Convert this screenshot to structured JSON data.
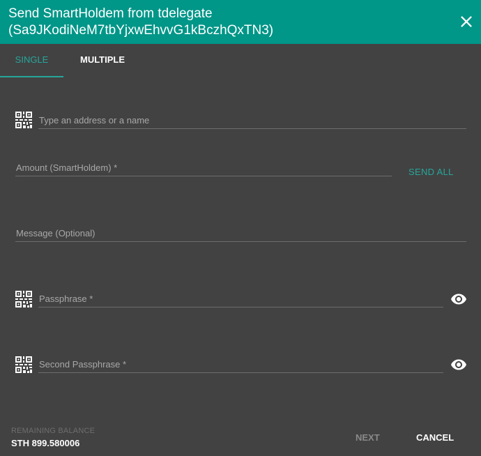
{
  "dialog": {
    "title_line1": "Send SmartHoldem from tdelegate",
    "title_line2": "(Sa9JKodiNeM7tbYjxwEhvvG1kBczhQxTN3)"
  },
  "tabs": [
    {
      "label": "SINGLE",
      "active": true
    },
    {
      "label": "MULTIPLE",
      "active": false
    }
  ],
  "form": {
    "address_placeholder": "Type an address or a name",
    "amount_label": "Amount (SmartHoldem) *",
    "send_all_label": "SEND ALL",
    "message_label": "Message (Optional)",
    "passphrase_label": "Passphrase *",
    "second_passphrase_label": "Second Passphrase *"
  },
  "footer": {
    "remaining_balance_label": "REMAINING BALANCE",
    "remaining_balance_value": "STH 899.580006",
    "next_label": "NEXT",
    "cancel_label": "CANCEL"
  },
  "icons": {
    "close": "close-icon",
    "qr": "qr-code-icon",
    "eye": "eye-icon"
  },
  "colors": {
    "header": "#009688",
    "accent": "#26a69a",
    "background": "#424242"
  }
}
